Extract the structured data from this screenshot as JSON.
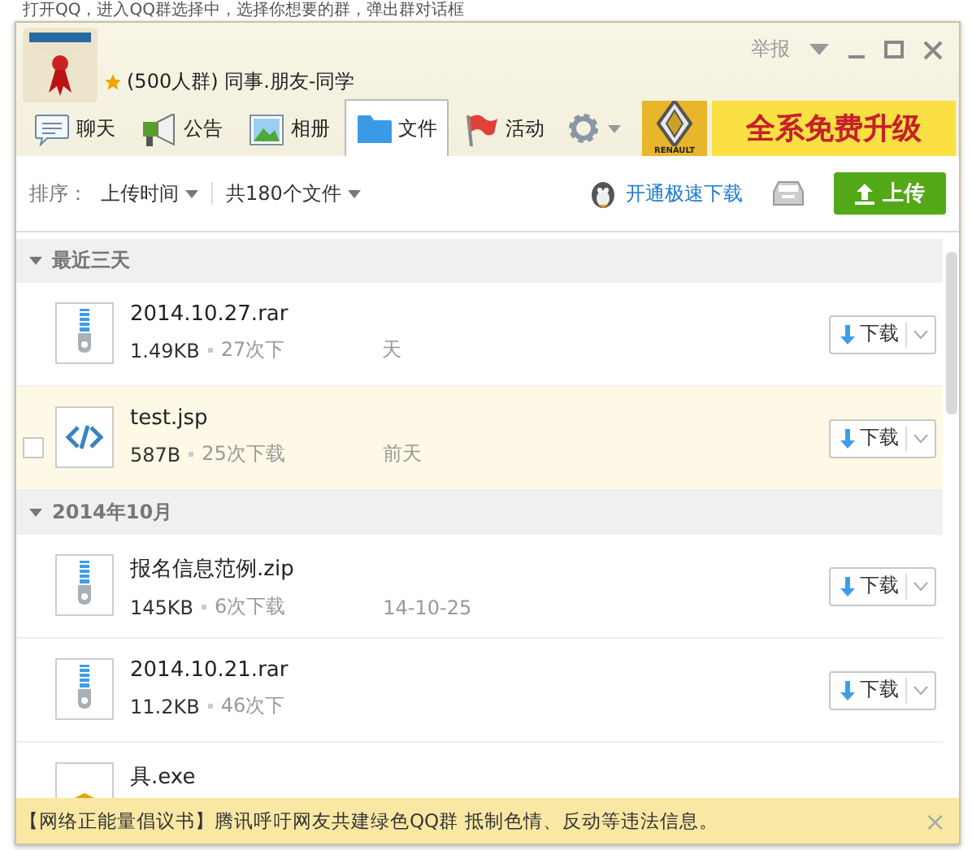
{
  "caption": "打开QQ，进入QQ群选择中，选择你想要的群，弹出群对话框",
  "window": {
    "group_info": "(500人群) 同事.朋友-同学",
    "report": "举报"
  },
  "tabs": [
    {
      "label": "聊天",
      "kind": "chat",
      "selected": false
    },
    {
      "label": "公告",
      "kind": "notice",
      "selected": false
    },
    {
      "label": "相册",
      "kind": "album",
      "selected": false
    },
    {
      "label": "文件",
      "kind": "file",
      "selected": true
    },
    {
      "label": "活动",
      "kind": "event",
      "selected": false
    }
  ],
  "ad": {
    "brand": "RENAULT",
    "slogan": "全系免费升级"
  },
  "toolbar": {
    "sort_label": "排序：",
    "sort_value": "上传时间",
    "count": "共180个文件",
    "speed_link": "开通极速下载",
    "upload": "上传"
  },
  "groups": [
    {
      "title": "最近三天",
      "expanded": true,
      "files": [
        {
          "name": "2014.10.27.rar",
          "kind": "archive",
          "highlighted": false,
          "size": "1.49KB",
          "downloads": "27次下",
          "date": "天",
          "button": "下载"
        },
        {
          "name": "test.jsp",
          "kind": "code",
          "highlighted": true,
          "size": "587B",
          "downloads": "25次下载",
          "date": "前天",
          "button": "下载"
        }
      ]
    },
    {
      "title": "2014年10月",
      "expanded": true,
      "files": [
        {
          "name": "报名信息范例.zip",
          "kind": "archive",
          "highlighted": false,
          "size": "145KB",
          "downloads": "6次下载",
          "date": "14-10-25",
          "button": "下载"
        },
        {
          "name": "2014.10.21.rar",
          "kind": "archive",
          "highlighted": false,
          "size": "11.2KB",
          "downloads": "46次下",
          "button": "下载"
        },
        {
          "name": "具.exe",
          "kind": "exe",
          "highlighted": false
        }
      ]
    }
  ],
  "notice": {
    "text": "【网络正能量倡议书】腾讯呼吁网友共建绿色QQ群 抵制色情、反动等违法信息。",
    "close": "×"
  }
}
